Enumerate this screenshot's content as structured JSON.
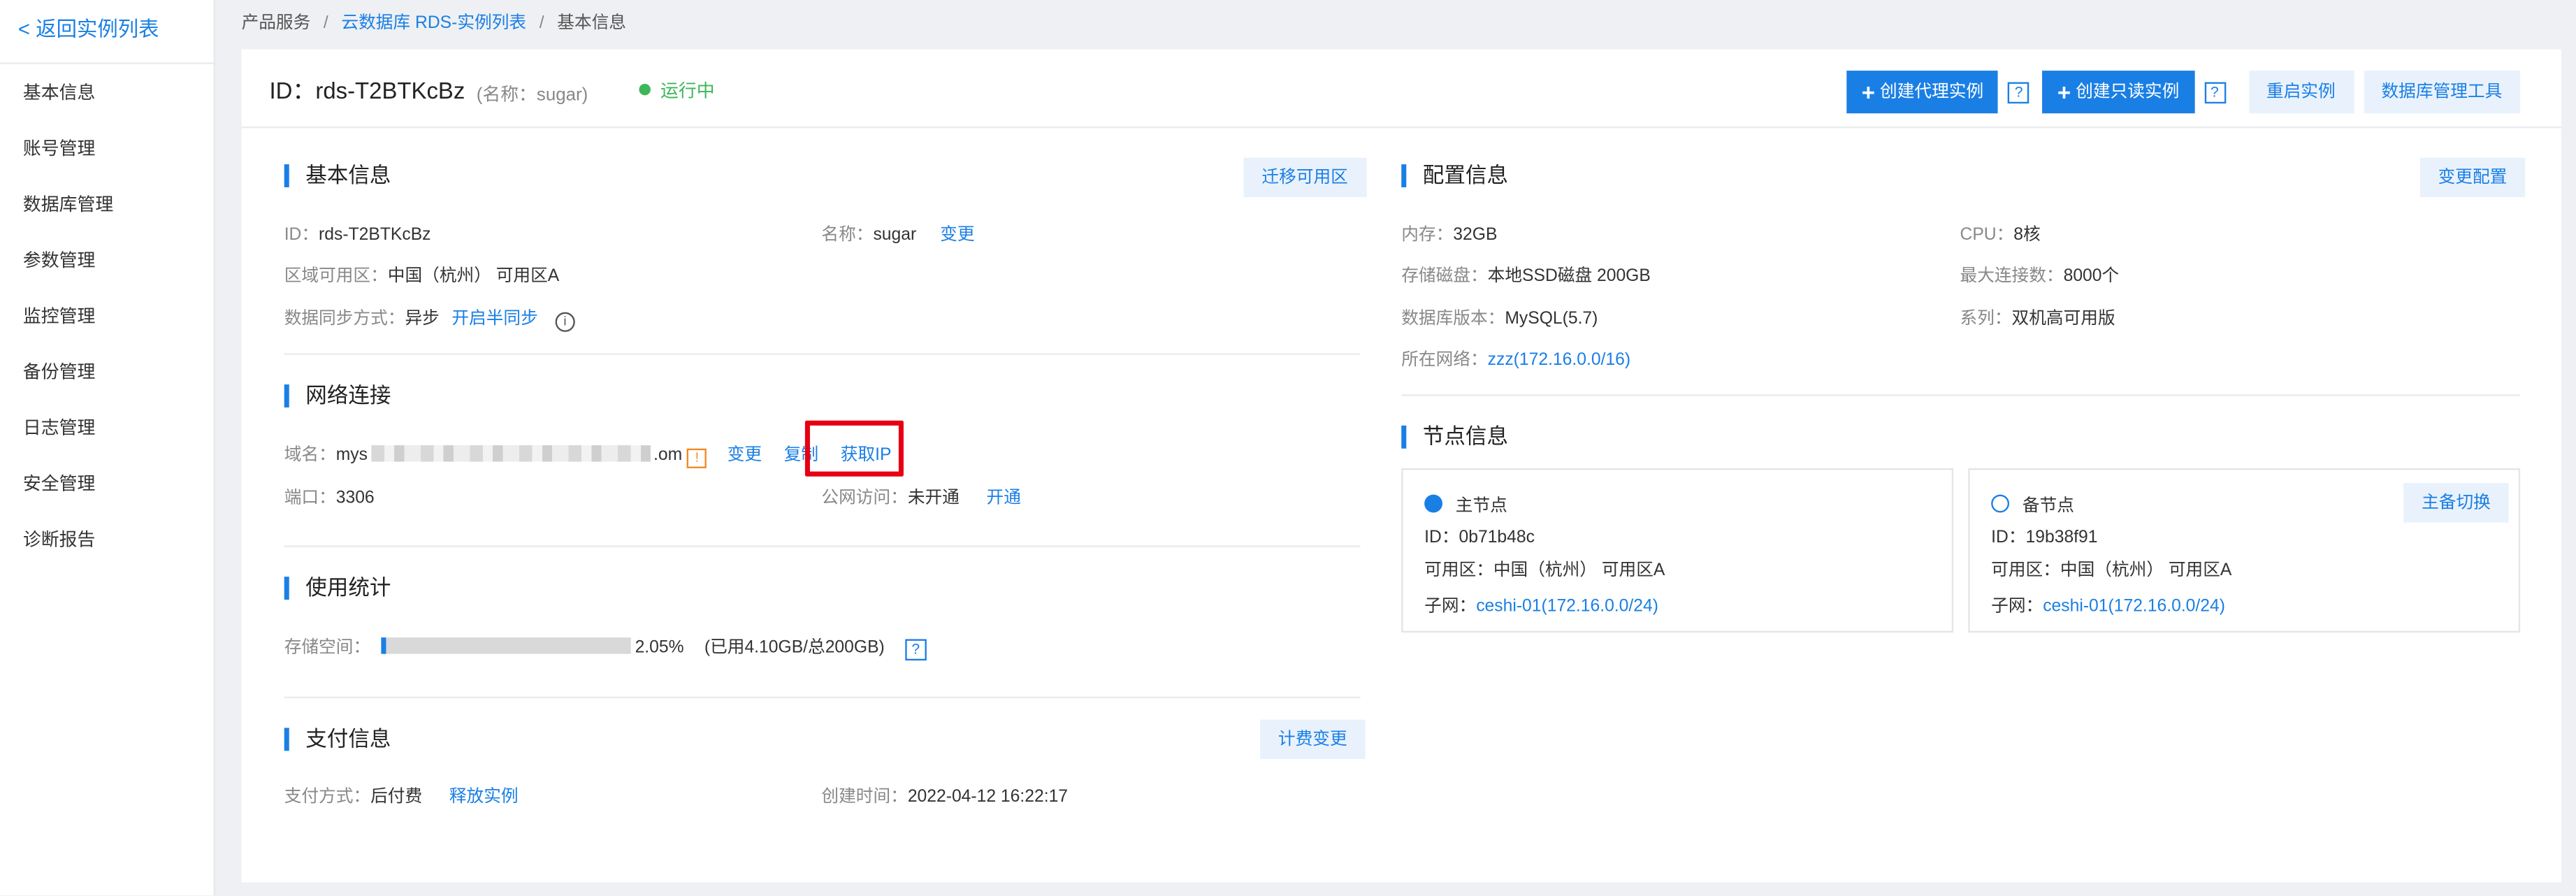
{
  "sidebar": {
    "back_label": "< 返回实例列表",
    "items": [
      {
        "label": "基本信息"
      },
      {
        "label": "账号管理"
      },
      {
        "label": "数据库管理"
      },
      {
        "label": "参数管理"
      },
      {
        "label": "监控管理"
      },
      {
        "label": "备份管理"
      },
      {
        "label": "日志管理"
      },
      {
        "label": "安全管理"
      },
      {
        "label": "诊断报告"
      }
    ]
  },
  "breadcrumb": {
    "item1": "产品服务",
    "item2": "云数据库 RDS-实例列表",
    "item3": "基本信息",
    "separator": "/"
  },
  "header": {
    "instance_id": "ID：rds-T2BTKcBz",
    "alias": "(名称：sugar)",
    "status": "运行中",
    "btn_proxy": "创建代理实例",
    "btn_readonly": "创建只读实例",
    "help": "?",
    "btn_restart": "重启实例",
    "btn_db_tool": "数据库管理工具"
  },
  "basic": {
    "title": "基本信息",
    "btn_migrate": "迁移可用区",
    "id_label": "ID：",
    "id_value": "rds-T2BTKcBz",
    "name_label": "名称：",
    "name_value": "sugar",
    "name_change": "变更",
    "zone_label": "区域可用区：",
    "zone_value": "中国（杭州） 可用区A",
    "sync_label": "数据同步方式：",
    "sync_value": "异步",
    "sync_link": "开启半同步",
    "info": "i"
  },
  "network": {
    "title": "网络连接",
    "domain_label": "域名：",
    "domain_prefix": "mys",
    "domain_suffix": ".om",
    "warn": "!",
    "change": "变更",
    "copy": "复制",
    "get_ip": "获取IP",
    "port_label": "端口：",
    "port_value": "3306",
    "public_label": "公网访问：",
    "public_value": "未开通",
    "public_link": "开通"
  },
  "usage": {
    "title": "使用统计",
    "storage_label": "存储空间：",
    "percent_fraction": 0.0205,
    "percent_text": "2.05%",
    "detail": "(已用4.10GB/总200GB)",
    "help": "?"
  },
  "billing": {
    "title": "支付信息",
    "btn_change": "计费变更",
    "pay_label": "支付方式：",
    "pay_value": "后付费",
    "release": "释放实例",
    "created_label": "创建时间：",
    "created_value": "2022-04-12 16:22:17"
  },
  "config": {
    "title": "配置信息",
    "btn_change": "变更配置",
    "mem_label": "内存：",
    "mem_value": "32GB",
    "cpu_label": "CPU：",
    "cpu_value": "8核",
    "disk_label": "存储磁盘：",
    "disk_value": "本地SSD磁盘 200GB",
    "maxconn_label": "最大连接数：",
    "maxconn_value": "8000个",
    "ver_label": "数据库版本：",
    "ver_value": "MySQL(5.7)",
    "series_label": "系列：",
    "series_value": "双机高可用版",
    "net_label": "所在网络：",
    "net_value": "zzz(172.16.0.0/16)"
  },
  "nodes": {
    "title": "节点信息",
    "primary": {
      "name": "主节点",
      "id": "ID：0b71b48c",
      "zone": "可用区：中国（杭州） 可用区A",
      "subnet_label": "子网：",
      "subnet_value": "ceshi-01(172.16.0.0/24)"
    },
    "standby": {
      "name": "备节点",
      "id": "ID：19b38f91",
      "zone": "可用区：中国（杭州） 可用区A",
      "subnet_label": "子网：",
      "subnet_value": "ceshi-01(172.16.0.0/24)",
      "switch_btn": "主备切换"
    }
  },
  "colors": {
    "accent": "#1a7fe5",
    "status_green": "#3eb65a",
    "highlight_red": "#e60012",
    "warn_orange": "#f08a24"
  }
}
